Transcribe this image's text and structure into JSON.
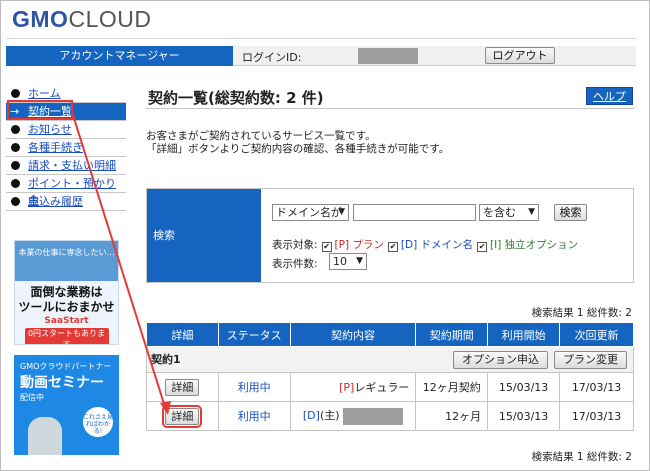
{
  "header": {
    "logo_bold": "GMO",
    "logo_light": "CLOUD",
    "account_manager": "アカウントマネージャー",
    "login_id_label": "ログインID:",
    "logout_label": "ログアウト"
  },
  "sidebar": {
    "items": [
      {
        "label": "ホーム"
      },
      {
        "label": "契約一覧"
      },
      {
        "label": "お知らせ"
      },
      {
        "label": "各種手続き"
      },
      {
        "label": "請求・支払い明細"
      },
      {
        "label": "ポイント・預かり金"
      },
      {
        "label": "申込み履歴"
      }
    ],
    "active_arrow": "→"
  },
  "ads": {
    "ad1_top": "本業の仕事に専念したい…",
    "ad1_line1": "面倒な業務は",
    "ad1_line2": "ツールにおまかせ",
    "ad1_brand": "SaaStart",
    "ad1_pill": "0円スタートもあります",
    "ad2_line1": "GMOクラウドパートナー",
    "ad2_line2": "動画セミナー",
    "ad2_line3": "配信中",
    "ad2_badge": "これさえ見ればわかる!"
  },
  "main": {
    "title": "契約一覧(総契約数: 2 件)",
    "help_label": "ヘルプ",
    "desc_line1": "お客さまがご契約されているサービス一覧です。",
    "desc_line2": "「詳細」ボタンよりご契約内容の確認、各種手続きが可能です。"
  },
  "search": {
    "label": "検索",
    "field_select": "ドメイン名が",
    "match_select": "を含む",
    "button": "検索",
    "display_target_label": "表示対象:",
    "opt_p": "[P] プラン",
    "opt_d": "[D] ドメイン名",
    "opt_i": "[I] 独立オプション",
    "count_label": "表示件数:",
    "count_value": "10"
  },
  "results": {
    "summary": "検索結果 1 総件数: 2",
    "headers": [
      "詳細",
      "ステータス",
      "契約内容",
      "契約期間",
      "利用開始",
      "次回更新"
    ],
    "group_label": "契約1",
    "option_button": "オプション申込",
    "plan_button": "プラン変更",
    "rows": [
      {
        "detail": "詳細",
        "status": "利用中",
        "content_prefix": "[P]",
        "content": "レギュラー",
        "period": "12ヶ月契約",
        "start": "15/03/13",
        "renew": "17/03/13"
      },
      {
        "detail": "詳細",
        "status": "利用中",
        "content_prefix": "[D]",
        "content": "(主)",
        "period": "12ヶ月",
        "start": "15/03/13",
        "renew": "17/03/13"
      }
    ]
  },
  "colors": {
    "accent": "#1565c0",
    "annotation": "#e53935"
  }
}
